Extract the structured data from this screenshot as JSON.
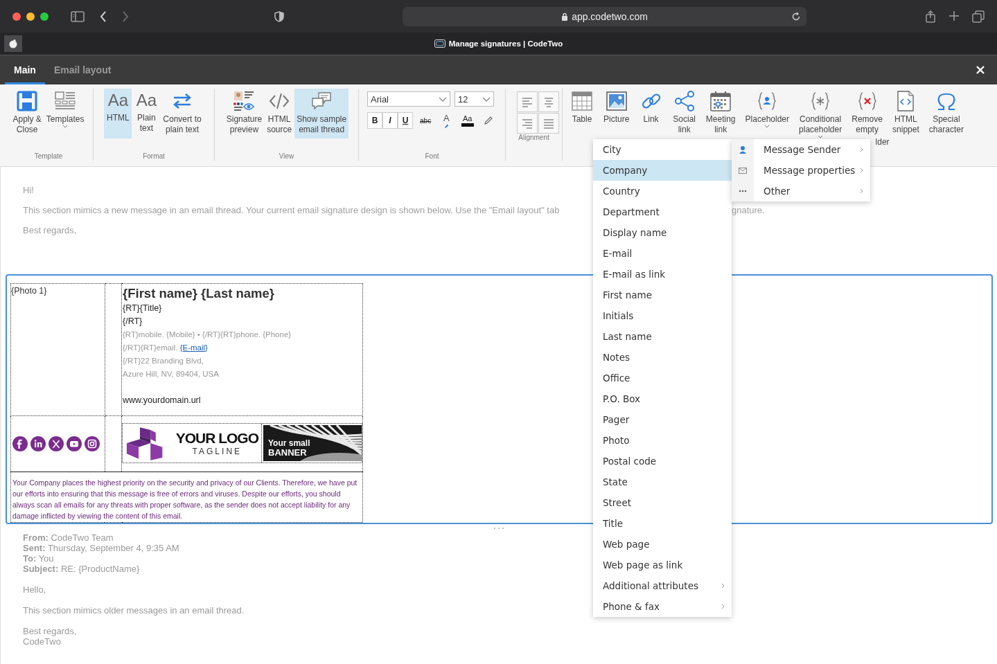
{
  "browser": {
    "url": "app.codetwo.com",
    "tab_title": "Manage signatures | CodeTwo"
  },
  "app_tabs": [
    {
      "label": "Main",
      "selected": true
    },
    {
      "label": "Email layout",
      "selected": false
    }
  ],
  "ribbon": {
    "groups": [
      {
        "kind": "buttons",
        "label": "Template",
        "buttons": [
          {
            "kind": "save",
            "lines": [
              "Apply &",
              "Close"
            ],
            "selected": false,
            "dropdown": false
          },
          {
            "kind": "templates",
            "lines": [
              "Templates"
            ],
            "selected": false,
            "dropdown": true
          }
        ]
      },
      {
        "kind": "buttons",
        "label": "Format",
        "buttons": [
          {
            "kind": "html",
            "glyph": "Aa",
            "lines": [
              "HTML"
            ],
            "selected": true,
            "dropdown": false
          },
          {
            "kind": "plain",
            "glyph": "Aa",
            "lines": [
              "Plain",
              "text"
            ],
            "selected": false,
            "dropdown": false
          },
          {
            "kind": "convert",
            "lines": [
              "Convert to",
              "plain text"
            ],
            "selected": false,
            "dropdown": false
          }
        ]
      },
      {
        "kind": "buttons",
        "label": "View",
        "buttons": [
          {
            "kind": "preview",
            "lines": [
              "Signature",
              "preview"
            ],
            "selected": false,
            "dropdown": false
          },
          {
            "kind": "source",
            "lines": [
              "HTML",
              "source"
            ],
            "selected": false,
            "dropdown": false
          },
          {
            "kind": "thread",
            "lines": [
              "Show sample",
              "email thread"
            ],
            "selected": true,
            "dropdown": false
          }
        ]
      },
      {
        "kind": "font",
        "label": "Font",
        "font_name": "Arial",
        "font_size": "12",
        "format_buttons": [
          {
            "kind": "bold",
            "text": "B"
          },
          {
            "kind": "italic",
            "text": "I"
          },
          {
            "kind": "underline",
            "text": "U"
          },
          {
            "kind": "strike",
            "text": "abc"
          },
          {
            "kind": "highlight",
            "text": "A"
          },
          {
            "kind": "color",
            "text": "Aa"
          },
          {
            "kind": "clear"
          }
        ]
      },
      {
        "kind": "alignment",
        "label": "Alignment",
        "buttons": [
          {
            "kind": "left"
          },
          {
            "kind": "center"
          },
          {
            "kind": "right"
          },
          {
            "kind": "justify"
          }
        ]
      },
      {
        "kind": "buttons",
        "buttons": [
          {
            "kind": "table",
            "lines": [
              "Table"
            ],
            "selected": false,
            "dropdown": false
          },
          {
            "kind": "picture",
            "lines": [
              "Picture"
            ],
            "selected": false,
            "dropdown": false
          },
          {
            "kind": "link",
            "lines": [
              "Link"
            ],
            "selected": false,
            "dropdown": false
          },
          {
            "kind": "social",
            "lines": [
              "Social",
              "link"
            ],
            "selected": false,
            "dropdown": false
          },
          {
            "kind": "meeting",
            "lines": [
              "Meeting",
              "link"
            ],
            "selected": false,
            "dropdown": false
          },
          {
            "kind": "placeholder",
            "lines": [
              "Placeholder"
            ],
            "selected": false,
            "dropdown": true
          },
          {
            "kind": "conditional",
            "lines": [
              "Conditional",
              "placeholder"
            ],
            "selected": false,
            "dropdown": true
          },
          {
            "kind": "remove",
            "lines": [
              "Remove",
              "empty"
            ],
            "tail": "lder",
            "selected": false,
            "dropdown": false
          },
          {
            "kind": "snippet",
            "lines": [
              "HTML",
              "snippet"
            ],
            "selected": false,
            "dropdown": false
          },
          {
            "kind": "special",
            "lines": [
              "Special",
              "character"
            ],
            "selected": false,
            "dropdown": false
          }
        ]
      }
    ]
  },
  "intro": {
    "greeting": "Hi!",
    "text_start": "This section mimics a new message in an email thread. Your current email signature design is shown below. Use the \"Email layout\" tab",
    "text_end": "gnature.",
    "closing": "Best regards,"
  },
  "signature": {
    "photo": "{Photo 1}",
    "name": "{First name} {Last name}",
    "lines": [
      {
        "kind": "dark",
        "text": "{RT}{Title}"
      },
      {
        "kind": "dark",
        "text": "{/RT}"
      },
      {
        "kind": "grey",
        "text": "{RT}mobile. {Mobile} • {/RT}{RT}phone. {Phone}"
      },
      {
        "kind": "link",
        "text": "{/RT}{RT}email. ",
        "link": "{E-mail}"
      },
      {
        "kind": "grey",
        "text": "{/RT}22 Branding Blvd,"
      },
      {
        "kind": "grey",
        "text": "Azure Hill, NV, 89404, USA"
      },
      {
        "kind": "gap"
      },
      {
        "kind": "dark",
        "text": "www.yourdomain.url"
      }
    ],
    "logo": {
      "title": "YOUR LOGO",
      "tagline": "TAGLINE"
    },
    "banner": {
      "line1": "Your small",
      "line2": "BANNER"
    },
    "disclaimer": "Your Company places the highest priority on the security and privacy of our Clients. Therefore, we have put our efforts into ensuring that this message is free of errors and viruses. Despite our efforts, you should always scan all emails for any threats with proper software, as the sender does not accept liability for any damage inflicted by viewing the content of this email."
  },
  "thread": {
    "headers": [
      "**From:** CodeTwo Team",
      "**Sent:** Thursday, September 4, 9:35 AM",
      "**To:** You",
      "**Subject:** RE: {ProductName}"
    ],
    "greeting": "Hello,",
    "text": "This section mimics older messages in an email thread.",
    "closing": [
      "Best regards,",
      "CodeTwo"
    ]
  },
  "placeholder_menu": {
    "items": [
      {
        "label": "City",
        "selected": false,
        "submenu": false
      },
      {
        "label": "Company",
        "selected": true,
        "submenu": false
      },
      {
        "label": "Country",
        "selected": false,
        "submenu": false
      },
      {
        "label": "Department",
        "selected": false,
        "submenu": false
      },
      {
        "label": "Display name",
        "selected": false,
        "submenu": false
      },
      {
        "label": "E-mail",
        "selected": false,
        "submenu": false
      },
      {
        "label": "E-mail as link",
        "selected": false,
        "submenu": false
      },
      {
        "label": "First name",
        "selected": false,
        "submenu": false
      },
      {
        "label": "Initials",
        "selected": false,
        "submenu": false
      },
      {
        "label": "Last name",
        "selected": false,
        "submenu": false
      },
      {
        "label": "Notes",
        "selected": false,
        "submenu": false
      },
      {
        "label": "Office",
        "selected": false,
        "submenu": false
      },
      {
        "label": "P.O. Box",
        "selected": false,
        "submenu": false
      },
      {
        "label": "Pager",
        "selected": false,
        "submenu": false
      },
      {
        "label": "Photo",
        "selected": false,
        "submenu": false
      },
      {
        "label": "Postal code",
        "selected": false,
        "submenu": false
      },
      {
        "label": "State",
        "selected": false,
        "submenu": false
      },
      {
        "label": "Street",
        "selected": false,
        "submenu": false
      },
      {
        "label": "Title",
        "selected": false,
        "submenu": false
      },
      {
        "label": "Web page",
        "selected": false,
        "submenu": false
      },
      {
        "label": "Web page as link",
        "selected": false,
        "submenu": false
      },
      {
        "label": "Additional attributes",
        "selected": false,
        "submenu": true
      },
      {
        "label": "Phone & fax",
        "selected": false,
        "submenu": true
      }
    ],
    "categories": [
      {
        "kind": "person",
        "label": "Message Sender",
        "submenu": true
      },
      {
        "kind": "envelope",
        "label": "Message properties",
        "submenu": true
      },
      {
        "kind": "dots",
        "label": "Other",
        "submenu": true
      }
    ]
  }
}
